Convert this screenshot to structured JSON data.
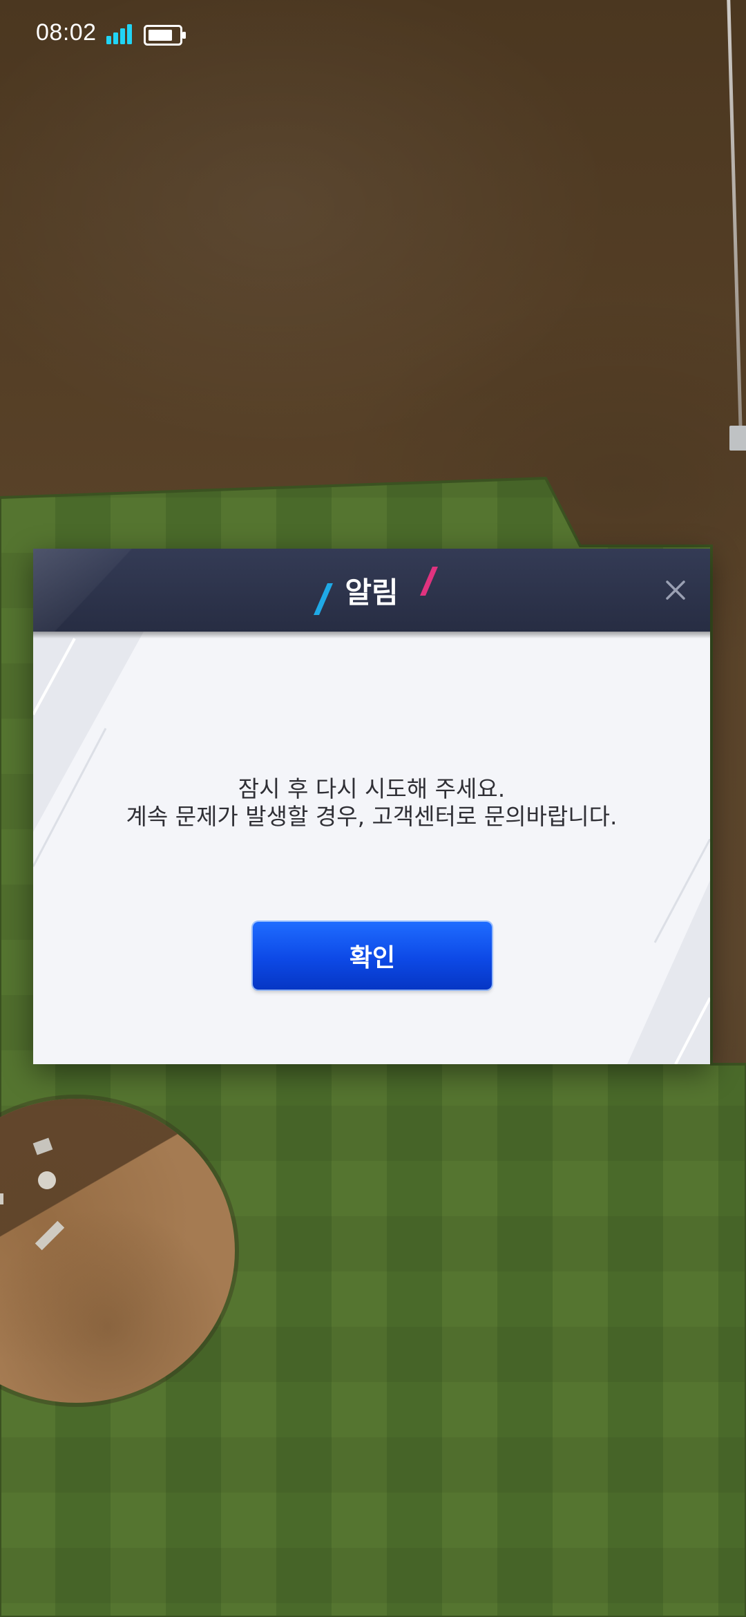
{
  "status_bar": {
    "time": "08:02",
    "signal_icon": "signal-bars-icon",
    "battery_icon": "battery-icon",
    "accent_color": "#21d4f5"
  },
  "dialog": {
    "title": "알림",
    "close_icon": "close-icon",
    "message_lines": [
      "잠시 후 다시 시도해 주세요.",
      "계속 문제가 발생할 경우, 고객센터로 문의바랍니다."
    ],
    "confirm_label": "확인",
    "colors": {
      "header": "#2b3148",
      "body": "#f4f5f9",
      "button": "#0d49e6",
      "accent_left": "#1fa9e6",
      "accent_right": "#e0337f"
    }
  }
}
